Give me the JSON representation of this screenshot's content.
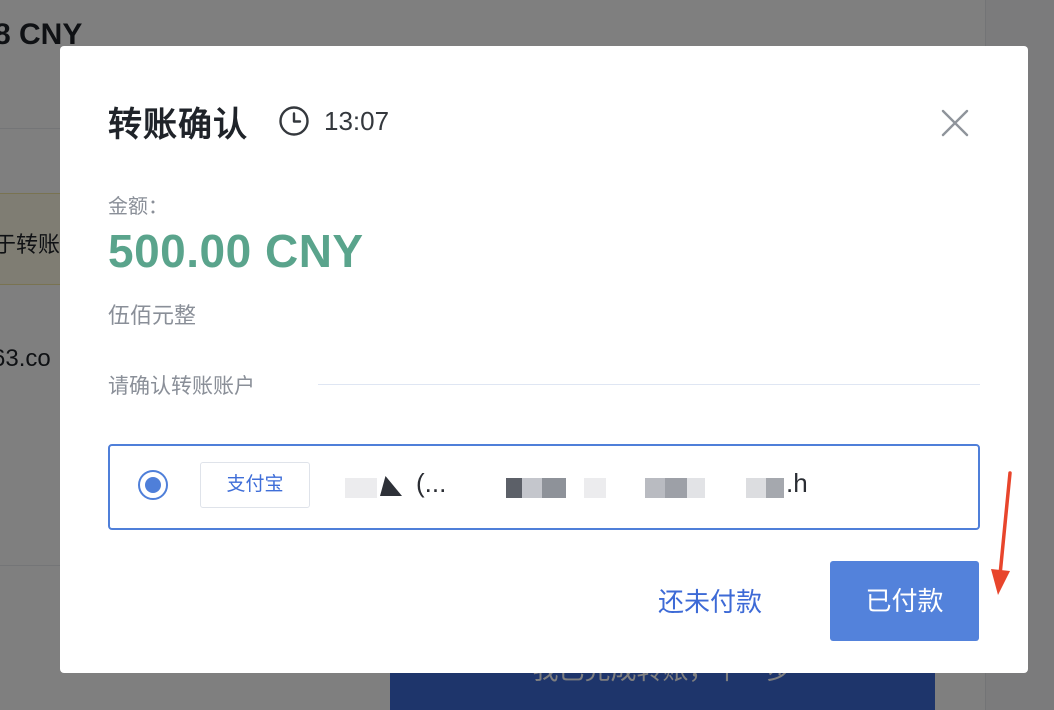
{
  "background": {
    "amount_partial": "8 CNY",
    "note_partial": "于转账。",
    "email_partial": "63.co",
    "cta_label": "我已完成转账，下一步"
  },
  "modal": {
    "title": "转账确认",
    "timer": "13:07",
    "amount_label": "金额：",
    "amount_value": "500.00 CNY",
    "amount_words": "伍佰元整",
    "section_label": "请确认转账账户",
    "account": {
      "method": "支付宝",
      "name_partial": "(...",
      "suffix": ".h"
    },
    "buttons": {
      "unpaid": "还未付款",
      "paid": "已付款"
    }
  },
  "colors": {
    "amount": "#5aa48c",
    "primary": "#5382db",
    "link": "#3d6ad6",
    "annotation_arrow": "#e8452c"
  },
  "icons": {
    "timer": "clock-icon",
    "close": "close-icon",
    "annotation": "red-arrow-icon"
  }
}
